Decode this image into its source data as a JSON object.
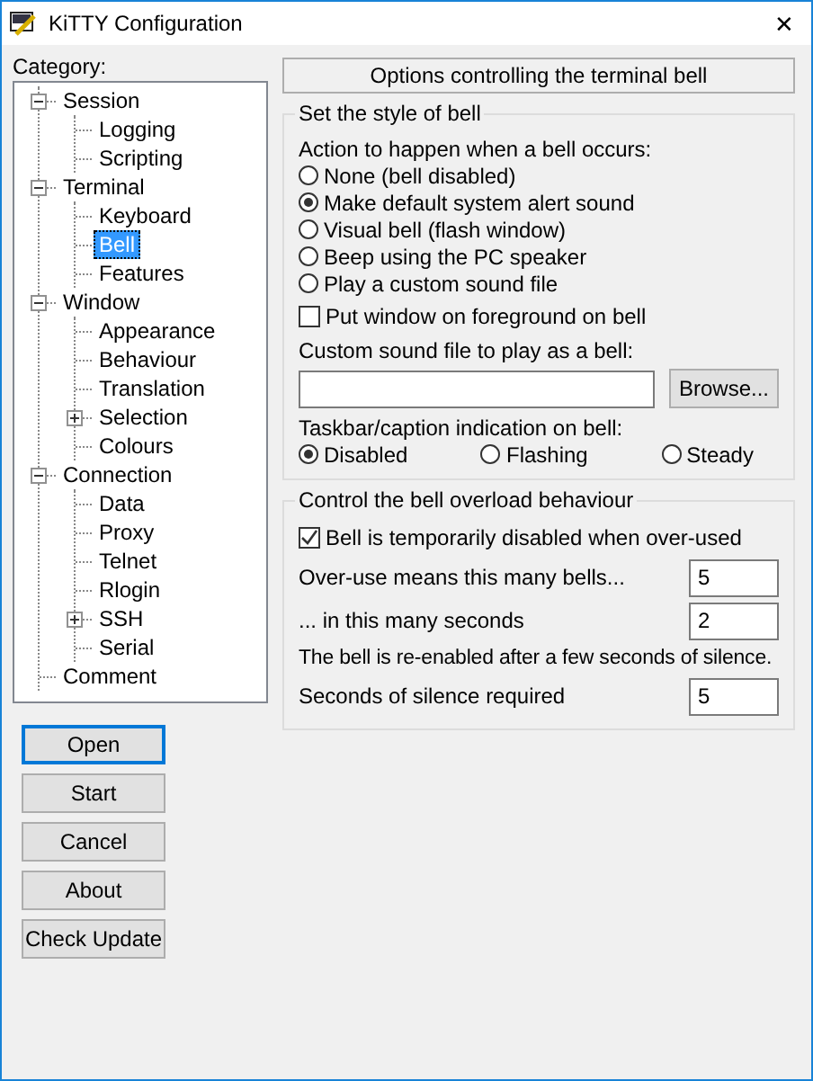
{
  "window": {
    "title": "KiTTY Configuration",
    "close": "✕"
  },
  "category_label": "Category:",
  "tree": [
    {
      "label": "Session",
      "expanded": true,
      "selected": false,
      "children": [
        {
          "label": "Logging",
          "selected": false
        },
        {
          "label": "Scripting",
          "selected": false
        }
      ]
    },
    {
      "label": "Terminal",
      "expanded": true,
      "selected": false,
      "children": [
        {
          "label": "Keyboard",
          "selected": false
        },
        {
          "label": "Bell",
          "selected": true
        },
        {
          "label": "Features",
          "selected": false
        }
      ]
    },
    {
      "label": "Window",
      "expanded": true,
      "selected": false,
      "children": [
        {
          "label": "Appearance",
          "selected": false
        },
        {
          "label": "Behaviour",
          "selected": false
        },
        {
          "label": "Translation",
          "selected": false
        },
        {
          "label": "Selection",
          "expanded": false,
          "selected": false
        },
        {
          "label": "Colours",
          "selected": false
        }
      ]
    },
    {
      "label": "Connection",
      "expanded": true,
      "selected": false,
      "children": [
        {
          "label": "Data",
          "selected": false
        },
        {
          "label": "Proxy",
          "selected": false
        },
        {
          "label": "Telnet",
          "selected": false
        },
        {
          "label": "Rlogin",
          "selected": false
        },
        {
          "label": "SSH",
          "expanded": false,
          "selected": false
        },
        {
          "label": "Serial",
          "selected": false
        }
      ]
    },
    {
      "label": "Comment",
      "selected": false
    }
  ],
  "buttons": [
    {
      "label": "Open",
      "default": true
    },
    {
      "label": "Start",
      "default": false
    },
    {
      "label": "Cancel",
      "default": false
    },
    {
      "label": "About",
      "default": false
    },
    {
      "label": "Check Update",
      "default": false
    }
  ],
  "header": "Options controlling the terminal bell",
  "style_group": {
    "title": "Set the style of bell",
    "action_label": "Action to happen when a bell occurs:",
    "actions": [
      {
        "label": "None (bell disabled)",
        "selected": false
      },
      {
        "label": "Make default system alert sound",
        "selected": true
      },
      {
        "label": "Visual bell (flash window)",
        "selected": false
      },
      {
        "label": "Beep using the PC speaker",
        "selected": false
      },
      {
        "label": "Play a custom sound file",
        "selected": false
      }
    ],
    "foreground": {
      "label": "Put window on foreground on bell",
      "checked": false
    },
    "sound_file_label": "Custom sound file to play as a bell:",
    "browse": "Browse...",
    "taskbar_label": "Taskbar/caption indication on bell:",
    "taskbar": [
      {
        "label": "Disabled",
        "selected": true
      },
      {
        "label": "Flashing",
        "selected": false
      },
      {
        "label": "Steady",
        "selected": false
      }
    ]
  },
  "overload_group": {
    "title": "Control the bell overload behaviour",
    "disable": {
      "label": "Bell is temporarily disabled when over-used",
      "checked": true
    },
    "bells": {
      "label": "Over-use means this many bells...",
      "value": "5"
    },
    "seconds": {
      "label": "... in this many seconds",
      "value": "2"
    },
    "note": "The bell is re-enabled after a few seconds of silence.",
    "silence": {
      "label": "Seconds of silence required",
      "value": "5"
    }
  }
}
